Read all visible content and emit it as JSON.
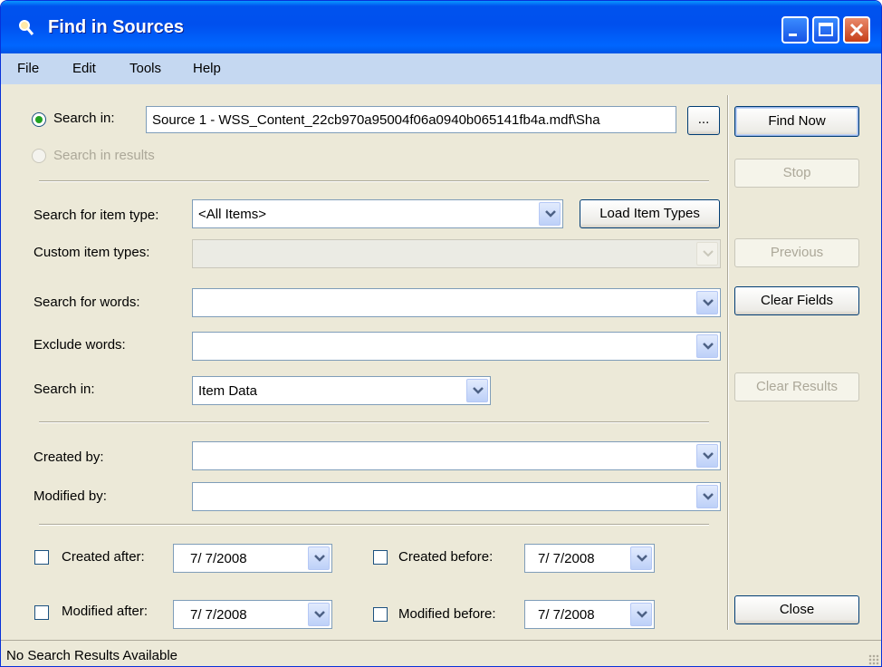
{
  "window": {
    "title": "Find in Sources"
  },
  "menu": [
    "File",
    "Edit",
    "Tools",
    "Help"
  ],
  "search_scope": {
    "search_in_label": "Search in:",
    "search_in_value": "Source 1 - WSS_Content_22cb970a95004f06a0940b065141fb4a.mdf\\Sha",
    "browse_label": "...",
    "search_in_results_label": "Search in results"
  },
  "fields": {
    "item_type_label": "Search for item type:",
    "item_type_value": "<All Items>",
    "load_item_types_label": "Load Item Types",
    "custom_item_types_label": "Custom item types:",
    "search_words_label": "Search for words:",
    "search_words_value": "",
    "exclude_words_label": "Exclude words:",
    "exclude_words_value": "",
    "search_in_label": "Search in:",
    "search_in_value": "Item Data",
    "created_by_label": "Created by:",
    "created_by_value": "",
    "modified_by_label": "Modified by:",
    "modified_by_value": ""
  },
  "dates": {
    "created_after_label": "Created after:",
    "created_after_value": "7/  7/2008",
    "created_before_label": "Created before:",
    "created_before_value": "7/  7/2008",
    "modified_after_label": "Modified after:",
    "modified_after_value": "7/  7/2008",
    "modified_before_label": "Modified before:",
    "modified_before_value": "7/  7/2008"
  },
  "buttons": {
    "find_now": "Find Now",
    "stop": "Stop",
    "previous": "Previous",
    "clear_fields": "Clear Fields",
    "clear_results": "Clear Results",
    "close": "Close"
  },
  "status": {
    "text": "No Search Results Available"
  },
  "colors": {
    "title_bar": "#0054e3",
    "menu_bar": "#c5d8f1",
    "dialog_bg": "#ece9d8",
    "radio_dot": "#21a121"
  },
  "icons": [
    "magnifier-icon",
    "minimize-icon",
    "maximize-icon",
    "close-icon",
    "chevron-down-icon",
    "resize-grip-icon"
  ]
}
